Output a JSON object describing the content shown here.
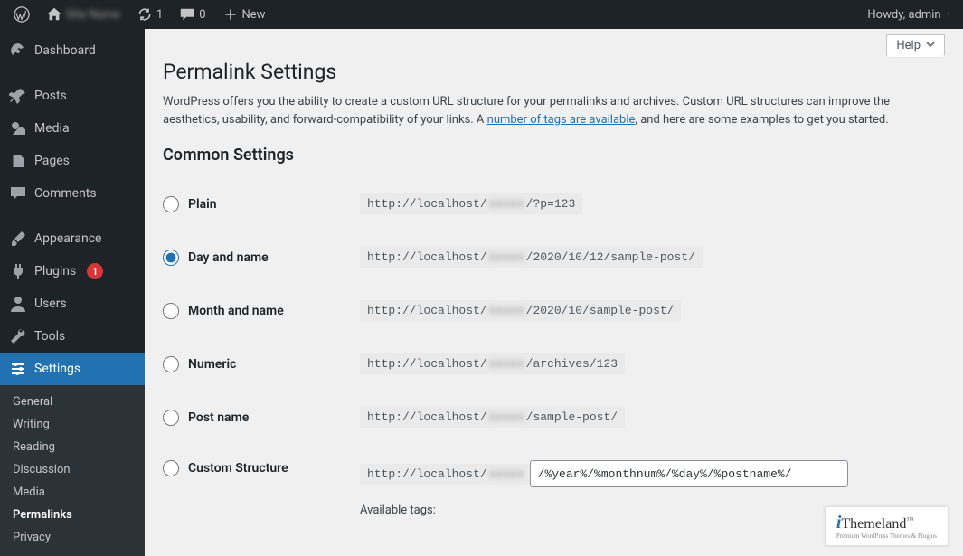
{
  "topbar": {
    "site_name_blurred": "Site Name",
    "updates_count": "1",
    "comments_count": "0",
    "new_label": "New",
    "greeting": "Howdy, admin"
  },
  "sidebar": {
    "items": [
      {
        "label": "Dashboard"
      },
      {
        "label": "Posts"
      },
      {
        "label": "Media"
      },
      {
        "label": "Pages"
      },
      {
        "label": "Comments"
      },
      {
        "label": "Appearance"
      },
      {
        "label": "Plugins",
        "badge": "1"
      },
      {
        "label": "Users"
      },
      {
        "label": "Tools"
      },
      {
        "label": "Settings"
      }
    ],
    "submenu": [
      {
        "label": "General"
      },
      {
        "label": "Writing"
      },
      {
        "label": "Reading"
      },
      {
        "label": "Discussion"
      },
      {
        "label": "Media"
      },
      {
        "label": "Permalinks"
      },
      {
        "label": "Privacy"
      }
    ]
  },
  "help_label": "Help",
  "page_title": "Permalink Settings",
  "intro_text_1": "WordPress offers you the ability to create a custom URL structure for your permalinks and archives. Custom URL structures can improve the aesthetics, usability, and forward-compatibility of your links. A ",
  "intro_link": "number of tags are available",
  "intro_text_2": ", and here are some examples to get you started.",
  "section_heading": "Common Settings",
  "blur_token": "xxxxx",
  "options": {
    "plain": {
      "label": "Plain",
      "prefix": "http://localhost/",
      "suffix": "/?p=123"
    },
    "dayname": {
      "label": "Day and name",
      "prefix": "http://localhost/",
      "suffix": "/2020/10/12/sample-post/"
    },
    "monthname": {
      "label": "Month and name",
      "prefix": "http://localhost/",
      "suffix": "/2020/10/sample-post/"
    },
    "numeric": {
      "label": "Numeric",
      "prefix": "http://localhost/",
      "suffix": "/archives/123"
    },
    "postname": {
      "label": "Post name",
      "prefix": "http://localhost/",
      "suffix": "/sample-post/"
    },
    "custom": {
      "label": "Custom Structure",
      "prefix": "http://localhost/",
      "value": "/%year%/%monthnum%/%day%/%postname%/"
    }
  },
  "available_tags_label": "Available tags:",
  "logo": {
    "i": "i",
    "rest": "Themeland",
    "tm": "™",
    "sub": "Premium WordPress Themes & Plugins"
  }
}
